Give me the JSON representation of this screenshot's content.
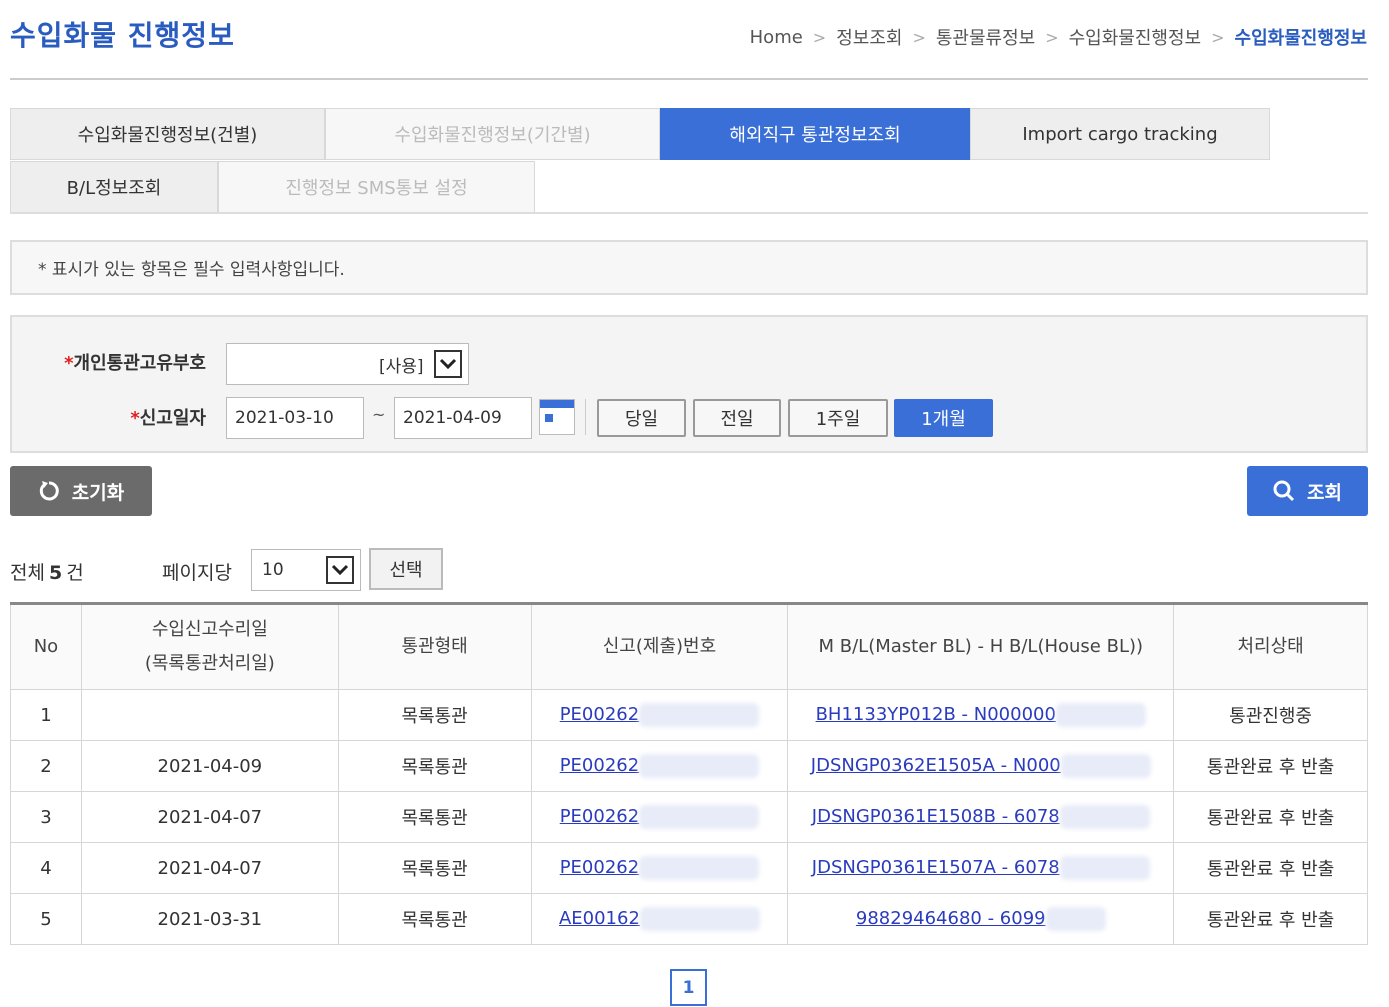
{
  "header": {
    "title": "수입화물 진행정보",
    "breadcrumb": [
      "Home",
      "정보조회",
      "통관물류정보",
      "수입화물진행정보",
      "수입화물진행정보"
    ],
    "breadcrumb_separator": ">"
  },
  "tabs": [
    {
      "label": "수입화물진행정보(건별)",
      "state": "normal"
    },
    {
      "label": "수입화물진행정보(기간별)",
      "state": "disabled"
    },
    {
      "label": "해외직구 통관정보조회",
      "state": "active"
    },
    {
      "label": "Import cargo tracking",
      "state": "normal"
    },
    {
      "label": "B/L정보조회",
      "state": "normal"
    },
    {
      "label": "진행정보 SMS통보 설정",
      "state": "disabled"
    }
  ],
  "notice": "* 표시가 있는 항목은 필수 입력사항입니다.",
  "form": {
    "required_mark": "*",
    "customs_code_label": "개인통관고유부호",
    "customs_code_value": "",
    "customs_code_use": "[사용]",
    "date_label": "신고일자",
    "date_from": "2021-03-10",
    "date_to": "2021-04-09",
    "date_separator": "~",
    "quick_buttons": [
      {
        "label": "당일",
        "active": false
      },
      {
        "label": "전일",
        "active": false
      },
      {
        "label": "1주일",
        "active": false
      },
      {
        "label": "1개월",
        "active": true
      }
    ]
  },
  "actions": {
    "reset_label": "초기화",
    "search_label": "조회"
  },
  "list_info": {
    "total_prefix": "전체",
    "total_count": "5",
    "total_suffix": "건",
    "per_page_label": "페이지당",
    "per_page_value": "10",
    "select_label": "선택"
  },
  "table": {
    "headers": [
      "No",
      "수입신고수리일",
      "(목록통관처리일)",
      "통관형태",
      "신고(제출)번호",
      "M B/L(Master BL) - H B/L(House BL))",
      "처리상태"
    ],
    "rows": [
      {
        "no": "1",
        "date": "",
        "type": "목록통관",
        "decl": "PE00262",
        "bl": "BH1133YP012B - N000000",
        "status": "통관진행중"
      },
      {
        "no": "2",
        "date": "2021-04-09",
        "type": "목록통관",
        "decl": "PE00262",
        "bl": "JDSNGP0362E1505A - N000",
        "status": "통관완료 후 반출"
      },
      {
        "no": "3",
        "date": "2021-04-07",
        "type": "목록통관",
        "decl": "PE00262",
        "bl": "JDSNGP0361E1508B - 6078",
        "status": "통관완료 후 반출"
      },
      {
        "no": "4",
        "date": "2021-04-07",
        "type": "목록통관",
        "decl": "PE00262",
        "bl": "JDSNGP0361E1507A - 6078",
        "status": "통관완료 후 반출"
      },
      {
        "no": "5",
        "date": "2021-03-31",
        "type": "목록통관",
        "decl": "AE00162",
        "bl": "98829464680 - 6099",
        "status": "통관완료 후 반출"
      }
    ]
  },
  "pagination": {
    "current": "1"
  },
  "colors": {
    "accent": "#3a6fd8",
    "title": "#2a5cc0",
    "link": "#2a3bbd",
    "required": "#e02020",
    "reset_button": "#6b6b6b"
  }
}
